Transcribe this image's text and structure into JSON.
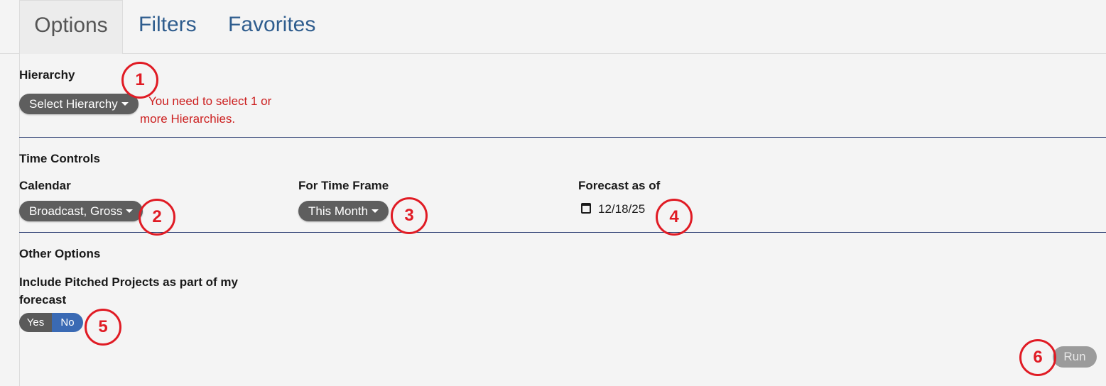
{
  "tabs": [
    {
      "label": "Options"
    },
    {
      "label": "Filters"
    },
    {
      "label": "Favorites"
    }
  ],
  "hierarchy": {
    "label": "Hierarchy",
    "button": "Select Hierarchy",
    "error": "You need to select 1 or more Hierarchies."
  },
  "time_controls": {
    "heading": "Time Controls",
    "calendar_label": "Calendar",
    "calendar_value": "Broadcast, Gross",
    "timeframe_label": "For Time Frame",
    "timeframe_value": "This Month",
    "forecast_label": "Forecast as of",
    "forecast_date": "12/18/25"
  },
  "other_options": {
    "heading": "Other Options",
    "pitched_label": "Include Pitched Projects as part of my forecast",
    "toggle_yes": "Yes",
    "toggle_no": "No",
    "selected": "No"
  },
  "run_button": "Run",
  "annotations": [
    "1",
    "2",
    "3",
    "4",
    "5",
    "6"
  ],
  "colors": {
    "tab_text": "#2f5d8e",
    "error": "#cc1f1f",
    "badge": "#e01b24",
    "toggle_selected": "#3a6ab4",
    "pill": "#5e5e5e",
    "divider": "#2d3f73"
  }
}
